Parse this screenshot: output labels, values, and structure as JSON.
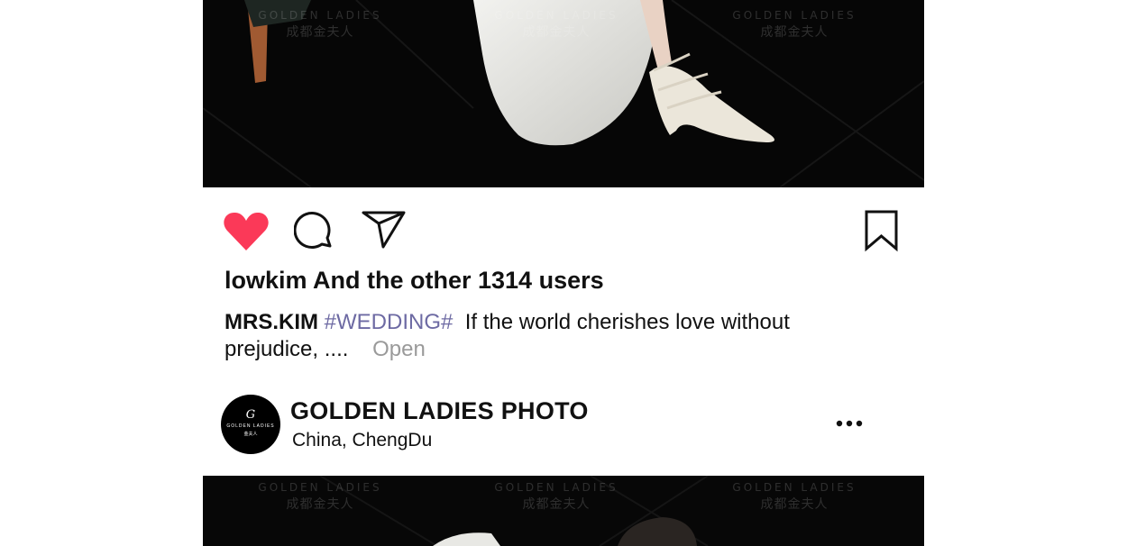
{
  "watermark": {
    "brand": "GOLDEN LADIES",
    "brand_cn": "成都金夫人"
  },
  "actions": {
    "like_icon": "heart-icon",
    "comment_icon": "speech-bubble-icon",
    "share_icon": "paper-plane-icon",
    "save_icon": "bookmark-icon",
    "like_color": "#fb3958"
  },
  "post": {
    "likes_text": "lowkim And the other 1314 users",
    "caption_user": "MRS.KIM",
    "caption_tag": "#WEDDING#",
    "caption_text": "If the world cherishes love without prejudice, ....",
    "open_label": "Open"
  },
  "account": {
    "avatar_monogram": "G",
    "avatar_brand": "GOLDEN LADIES",
    "avatar_brand_cn": "金夫人",
    "name": "GOLDEN LADIES PHOTO",
    "location": "China, ChengDu",
    "more_icon": "more-dots-icon"
  },
  "colors": {
    "tag": "#6d6aa3",
    "open": "#9a9a9a"
  }
}
